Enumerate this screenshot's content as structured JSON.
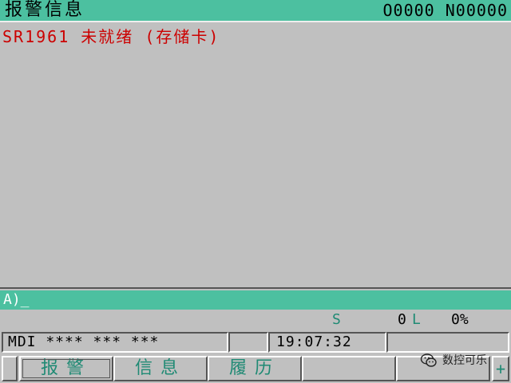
{
  "header": {
    "title": "报警信息",
    "program": "O0000 N00000"
  },
  "alarm": {
    "text": "SR1961 未就绪 (存储卡)"
  },
  "input": {
    "prompt": "A)_"
  },
  "spindle": {
    "s_label": "S",
    "s_value": "0",
    "l_label": "L",
    "l_value": "0%"
  },
  "status": {
    "mode": "MDI  **** *** ***",
    "time": "19:07:32"
  },
  "softkeys": {
    "key1": "报警",
    "key2": "信息",
    "key3": "履历",
    "key4": "",
    "key5": "",
    "right": "+"
  },
  "watermark": {
    "icon": "wechat-icon",
    "text": "数控可乐"
  },
  "colors": {
    "bar": "#4cc0a0",
    "alarm": "#cc0000",
    "softkey_text": "#1f8a74",
    "background": "#c0c0c0"
  }
}
